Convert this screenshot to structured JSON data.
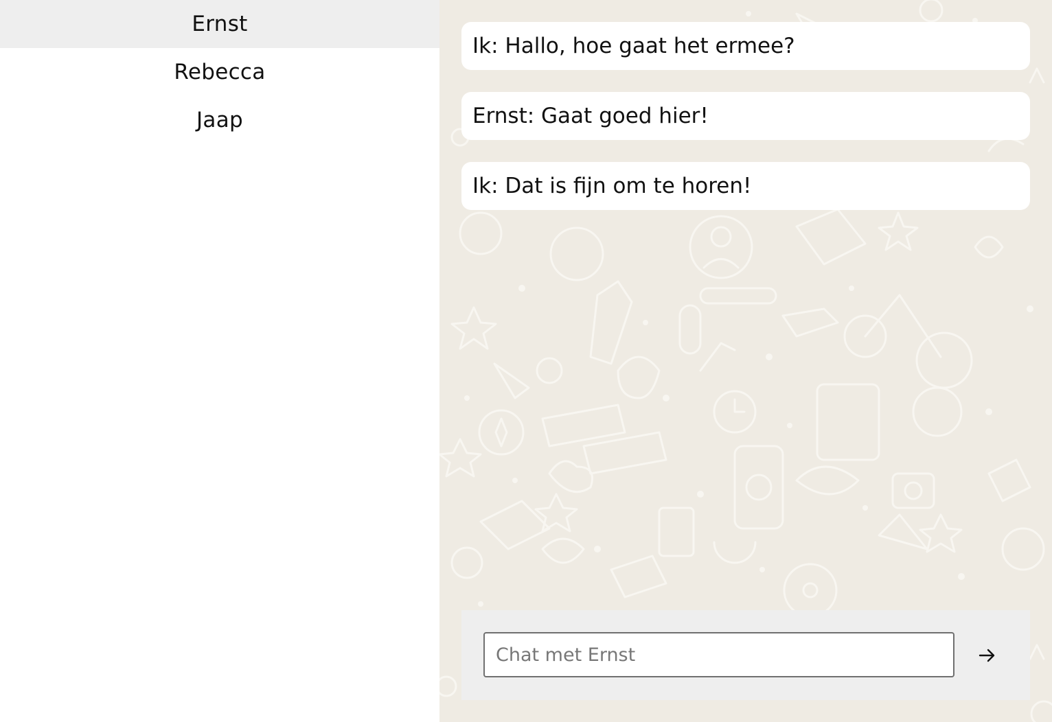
{
  "contacts": [
    {
      "name": "Ernst",
      "active": true
    },
    {
      "name": "Rebecca",
      "active": false
    },
    {
      "name": "Jaap",
      "active": false
    }
  ],
  "messages": [
    {
      "text": "Ik: Hallo, hoe gaat het ermee?"
    },
    {
      "text": "Ernst: Gaat goed hier!"
    },
    {
      "text": "Ik: Dat is fijn om te horen!"
    }
  ],
  "composer": {
    "placeholder": "Chat met Ernst",
    "value": "",
    "send_icon": "arrow-right-icon"
  },
  "colors": {
    "sidebar_active": "#eeeeee",
    "chat_background": "#efebe3",
    "bubble": "#ffffff",
    "composer_background": "#eeeeee"
  }
}
